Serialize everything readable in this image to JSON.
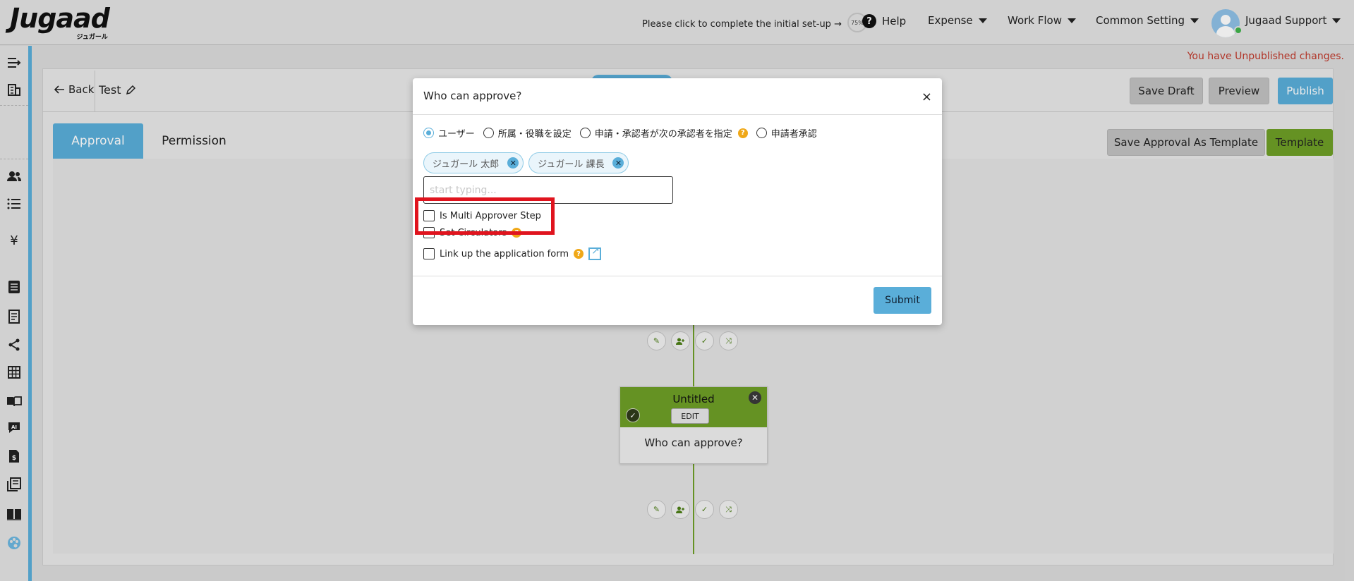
{
  "header": {
    "logo_text": "Jugaad",
    "logo_sub": "ジュガール",
    "setup_text": "Please click to complete the initial set-up →",
    "setup_progress": "75%",
    "help_label": "Help",
    "nav": [
      {
        "label": "Expense"
      },
      {
        "label": "Work Flow"
      },
      {
        "label": "Common Setting"
      }
    ],
    "user_name": "Jugaad Support"
  },
  "sidebar": {
    "icons": [
      "sidebar-toggle-icon",
      "building-icon",
      "users-icon",
      "list-icon",
      "yen-icon",
      "document-icon",
      "receipt-icon",
      "share-icon",
      "grid-icon",
      "book-icon",
      "ai-icon",
      "invoice-icon",
      "library-icon",
      "manual-icon",
      "palette-icon"
    ]
  },
  "notice": "You have Unpublished changes.",
  "workflow": {
    "back_label": "Back",
    "title": "Test",
    "save_draft": "Save Draft",
    "preview": "Preview",
    "publish": "Publish"
  },
  "tabs": [
    {
      "label": "Approval"
    },
    {
      "label": "Permission"
    }
  ],
  "template_actions": {
    "save_as_template": "Save Approval As Template",
    "template": "Template"
  },
  "step": {
    "title": "Untitled",
    "edit_label": "EDIT",
    "body": "Who can approve?"
  },
  "modal": {
    "title": "Who can approve?",
    "radios": [
      {
        "label": "ユーザー",
        "checked": true
      },
      {
        "label": "所属・役職を設定",
        "checked": false
      },
      {
        "label": "申請・承認者が次の承認者を指定",
        "checked": false
      },
      {
        "label": "申請者承認",
        "checked": false
      }
    ],
    "chips": [
      "ジュガール 太郎",
      "ジュガール 課長"
    ],
    "input_placeholder": "start typing...",
    "checkboxes": [
      {
        "label": "Is Multi Approver Step",
        "checked": false
      },
      {
        "label": "Set Circulators",
        "checked": false
      },
      {
        "label": "Link up the application form",
        "checked": false
      }
    ],
    "submit_label": "Submit"
  },
  "colors": {
    "accent_blue": "#5aaed9",
    "green": "#6e9f26",
    "highlight_red": "#e0141e",
    "notice_red": "#c0392b"
  }
}
